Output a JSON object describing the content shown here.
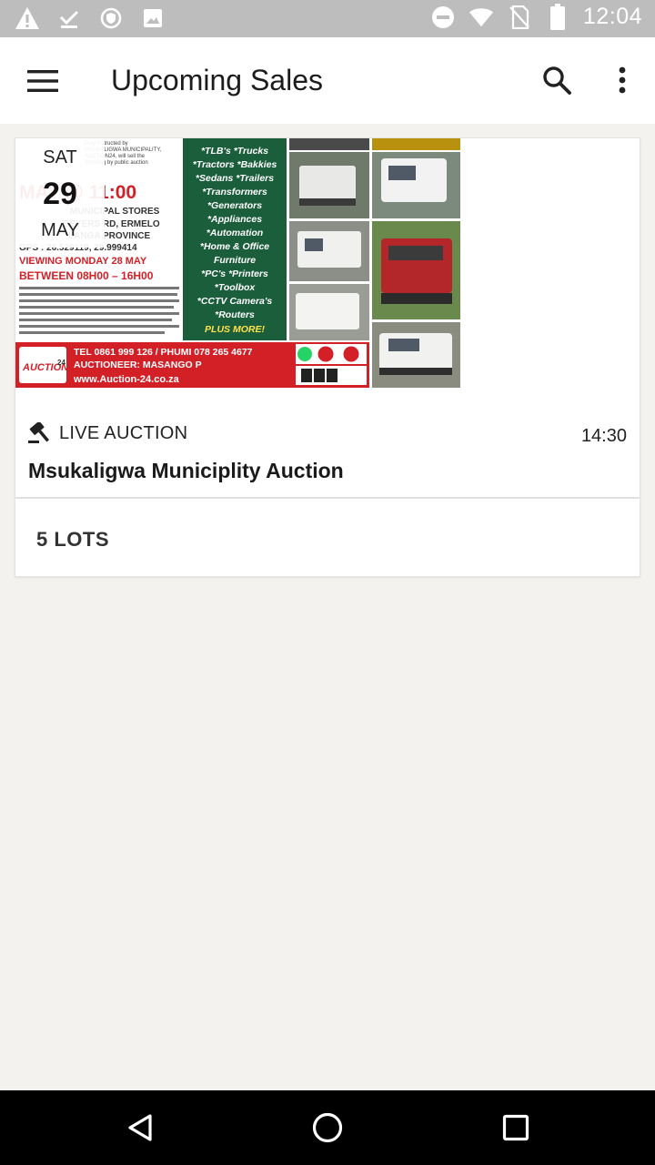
{
  "status_bar": {
    "time": "12:04",
    "icons": [
      "warning-icon",
      "download-done-icon",
      "shield-icon",
      "image-icon",
      "do-not-disturb-icon",
      "wifi-icon",
      "no-sim-icon",
      "battery-icon"
    ]
  },
  "app_bar": {
    "title": "Upcoming Sales",
    "icons": [
      "menu-icon",
      "search-icon",
      "more-vert-icon"
    ]
  },
  "auction_card": {
    "date": {
      "day_of_week": "SAT",
      "day": "29",
      "month": "MAY"
    },
    "type_label": "LIVE AUCTION",
    "time": "14:30",
    "title": "Msukaligwa Municiplity Auction",
    "lots_label": "5 LOTS",
    "poster": {
      "header_time": "MAY @ 11:00",
      "venue_lines": [
        "MUNICIPAL STORES",
        "BEYERS RD, ERMELO",
        "LANGA PROVINCE",
        "GPS : 26.529119, 29.999414"
      ],
      "intro": "Duly instructed by MSUKALIGWA MUNICIPALITY, AUCTION24, will sell the following by public auction",
      "viewing": "VIEWING MONDAY 28 MAY",
      "viewing_hours": "BETWEEN 08H00 – 16H00",
      "terms": "TERMS & CONDITIONS: Reg: R10 000 (bank guaranteed cheque/EFT only) Buyers must bring FICA documents. Handling & Buyer's premium will be payable. The RULES OF THE AUCTION COMPLY WITH THE CONSUMER PROTECTION ACT. 68 OF 2008. \"Above subject to change without prior notice \"(e & oe). (For full T's & C's & auction list visit our website)",
      "items": [
        "*TLB's *Trucks",
        "*Tractors *Bakkies",
        "*Sedans *Trailers",
        "*Transformers",
        "*Generators",
        "*Appliances",
        "*Automation",
        "*Home & Office",
        "Furniture",
        "*PC's *Printers",
        "*Toolbox",
        "*CCTV Camera's",
        "*Routers",
        "PLUS MORE!"
      ],
      "contact": "TEL 0861 999 126 / PHUMI 078 265 4677",
      "auctioneer": "AUCTIONEER: MASANGO P",
      "website": "www.Auction-24.co.za",
      "logo_text": "AUCTION",
      "logo_num": "24",
      "colors": {
        "red": "#d32027",
        "green": "#1b5e3c",
        "yellow": "#ffe14a"
      }
    }
  },
  "nav_bar": {
    "icons": [
      "back-icon",
      "home-icon",
      "recents-icon"
    ]
  }
}
